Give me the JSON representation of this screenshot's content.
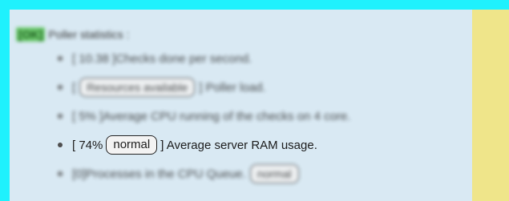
{
  "header": {
    "status_badge": "[OK]",
    "title": "Poller statistics :"
  },
  "stats": [
    {
      "prefix": "[ 10.38 ]",
      "middle": "",
      "suffix": "Checks done per second."
    },
    {
      "prefix": "[",
      "middle": "Resources available",
      "suffix": "] Poller load."
    },
    {
      "prefix": "[ 5% ]",
      "middle": "",
      "suffix": "Average CPU running of the checks on 4 core."
    },
    {
      "prefix": "[ 74%",
      "middle": "normal",
      "suffix": "] Average server RAM usage."
    },
    {
      "prefix": "[0]",
      "middle": "",
      "suffix": "Processes in the CPU Queue.",
      "tag": "normal"
    }
  ],
  "colors": {
    "page_background": "#1ff1fd",
    "panel_background": "#d9e9f3",
    "side_panel": "#efe58a",
    "ok_badge": "#6cc96d"
  }
}
